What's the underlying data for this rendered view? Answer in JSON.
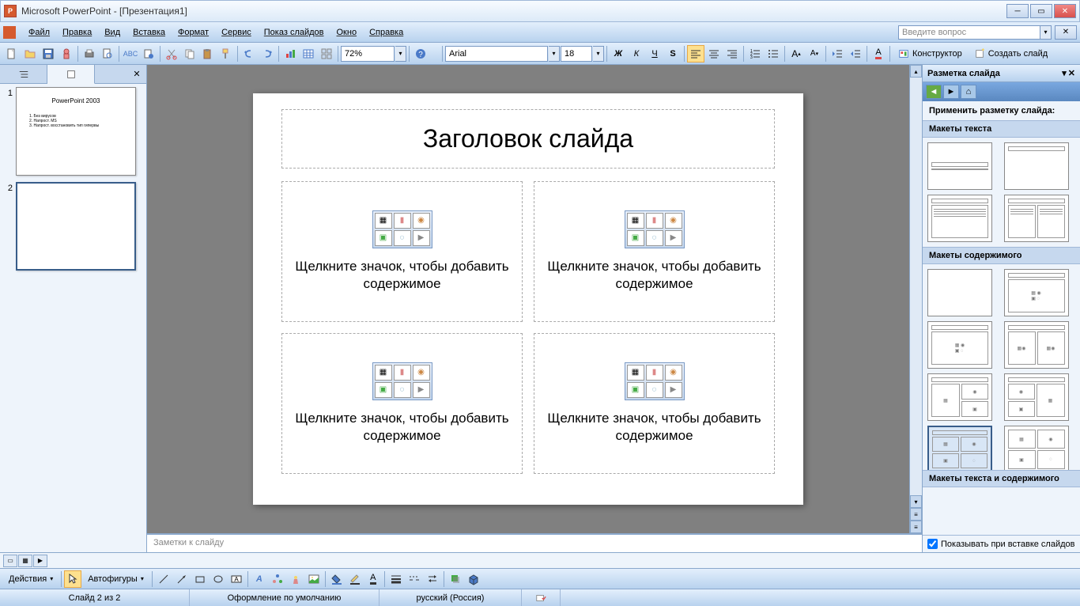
{
  "title": "Microsoft PowerPoint - [Презентация1]",
  "menus": [
    "Файл",
    "Правка",
    "Вид",
    "Вставка",
    "Формат",
    "Сервис",
    "Показ слайдов",
    "Окно",
    "Справка"
  ],
  "ask_placeholder": "Введите вопрос",
  "zoom": "72%",
  "font": "Arial",
  "font_size": "18",
  "designer_btn": "Конструктор",
  "new_slide_btn": "Создать слайд",
  "slide_title_placeholder": "Заголовок слайда",
  "content_placeholder": "Щелкните значок, чтобы добавить содержимое",
  "notes_placeholder": "Заметки к слайду",
  "thumb1_title": "PowerPoint 2003",
  "thumb1_items": [
    "1. Без вирусов",
    "2. Напрост. MS",
    "3. Напрост. восстановить тип гипервы"
  ],
  "taskpane": {
    "title": "Разметка слайда",
    "apply": "Применить разметку слайда:",
    "sec_text": "Макеты текста",
    "sec_content": "Макеты содержимого",
    "sec_text_content": "Макеты текста и содержимого",
    "show_on_insert": "Показывать при вставке слайдов"
  },
  "draw": {
    "actions": "Действия",
    "autoshapes": "Автофигуры"
  },
  "status": {
    "slide": "Слайд 2 из 2",
    "design": "Оформление по умолчанию",
    "lang": "русский (Россия)"
  },
  "slides": [
    1,
    2
  ]
}
